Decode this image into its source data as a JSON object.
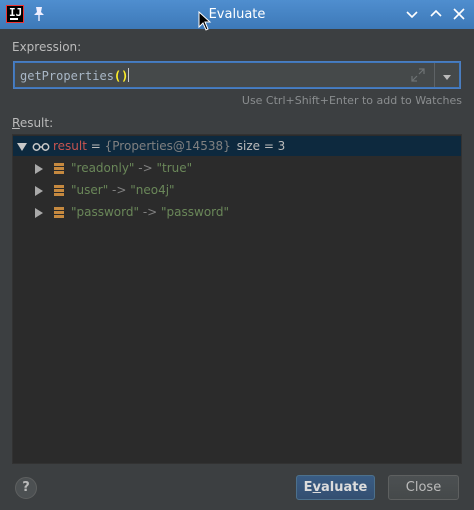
{
  "window": {
    "title": "Evaluate",
    "app_icon_text": "IJ"
  },
  "expression": {
    "label": "Expression:",
    "value_prefix": "getProperties",
    "value_parens": "()"
  },
  "hint": "Use Ctrl+Shift+Enter to add to Watches",
  "result": {
    "label_first": "R",
    "label_rest": "esult:",
    "root": {
      "name": "result",
      "eq": " = ",
      "type": "{Properties@14538}",
      "size": "size = 3"
    },
    "entries": [
      {
        "key": "\"readonly\"",
        "arrow": " -> ",
        "value": "\"true\""
      },
      {
        "key": "\"user\"",
        "arrow": " -> ",
        "value": "\"neo4j\""
      },
      {
        "key": "\"password\"",
        "arrow": " -> ",
        "value": "\"password\""
      }
    ]
  },
  "buttons": {
    "help": "?",
    "evaluate_first": "E",
    "evaluate_u": "v",
    "evaluate_rest": "aluate",
    "close": "Close"
  },
  "colors": {
    "accent": "#3d79b8",
    "selection": "#0d293e",
    "string": "#6a8759"
  }
}
